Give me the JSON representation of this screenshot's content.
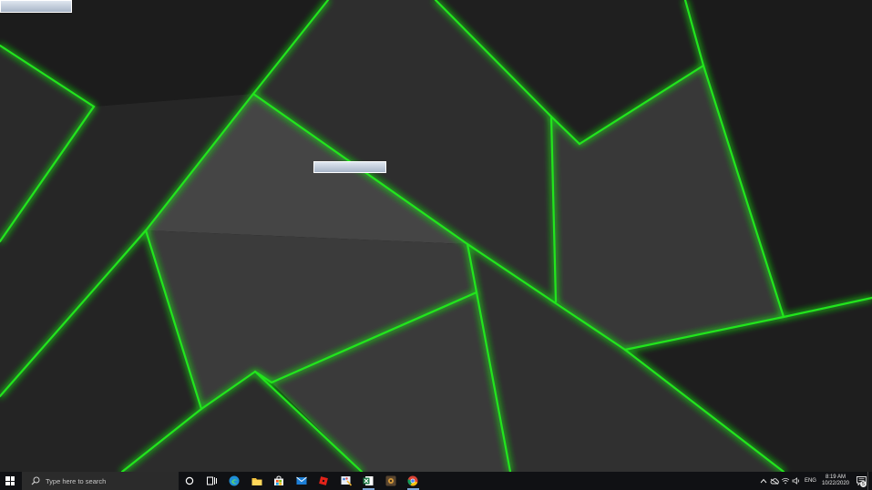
{
  "desktop": {
    "wallpaper": {
      "theme": "dark geometric low-poly with neon green edges",
      "line_color": "#22e51f",
      "base_color": "#151515"
    }
  },
  "taskbar": {
    "search": {
      "placeholder": "Type here to search"
    },
    "pinned": [
      {
        "name": "cortana-icon"
      },
      {
        "name": "task-view-icon"
      },
      {
        "name": "edge-icon"
      },
      {
        "name": "file-explorer-icon"
      },
      {
        "name": "store-icon"
      },
      {
        "name": "mail-icon"
      },
      {
        "name": "roblox-icon"
      },
      {
        "name": "paint-icon"
      },
      {
        "name": "excel-icon"
      },
      {
        "name": "game-icon"
      },
      {
        "name": "chrome-icon"
      }
    ],
    "tray": {
      "language": "ENG",
      "time": "8:19 AM",
      "date": "10/22/2020",
      "notification_count": "5"
    }
  }
}
